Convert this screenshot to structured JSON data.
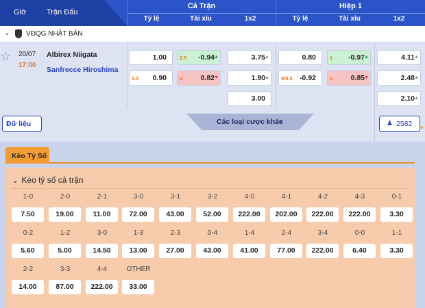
{
  "header": {
    "gio": "Giờ",
    "tran_dau": "Trận Đấu",
    "ca_tran": "Cả Trận",
    "hiep_1": "Hiệp 1",
    "ty_le": "Tỷ lệ",
    "tai_xiu": "Tài xỉu",
    "x12": "1x2"
  },
  "league": {
    "name": "VĐQG NHẬT BẢN"
  },
  "match": {
    "date": "20/07",
    "time": "17:00",
    "home": "Albirex Niigata",
    "away": "Sanfrecce Hiroshima",
    "full": {
      "tyle1": {
        "val": "1.00"
      },
      "tyle2": {
        "pre": "0.5",
        "val": "0.90"
      },
      "tx1": {
        "pre": "2.5",
        "val": "-0.94"
      },
      "tx2": {
        "pre": "u",
        "val": "0.82"
      },
      "x1": "3.75",
      "x2": "1.90",
      "x3": "3.00"
    },
    "half": {
      "tyle1": {
        "val": "0.80"
      },
      "tyle2": {
        "pre": "0/0.5",
        "val": "-0.92"
      },
      "tx1": {
        "pre": "1",
        "val": "-0.97"
      },
      "tx2": {
        "pre": "u",
        "val": "0.85"
      },
      "x1": "4.11",
      "x2": "2.48",
      "x3": "2.10"
    },
    "du_lieu": "Dữ liệu",
    "cac_loai": "Các loại cược khác",
    "count": "2582"
  },
  "tab": {
    "label": "Kèo Tỷ Số"
  },
  "panel": {
    "title": "Kèo tỷ số cả trận",
    "scores": [
      {
        "label": "1-0",
        "odds": "7.50"
      },
      {
        "label": "2-0",
        "odds": "19.00"
      },
      {
        "label": "2-1",
        "odds": "11.00"
      },
      {
        "label": "3-0",
        "odds": "72.00"
      },
      {
        "label": "3-1",
        "odds": "43.00"
      },
      {
        "label": "3-2",
        "odds": "52.00"
      },
      {
        "label": "4-0",
        "odds": "222.00"
      },
      {
        "label": "4-1",
        "odds": "202.00"
      },
      {
        "label": "4-2",
        "odds": "222.00"
      },
      {
        "label": "4-3",
        "odds": "222.00"
      },
      {
        "label": "0-1",
        "odds": "3.30"
      },
      {
        "label": "0-2",
        "odds": "5.60"
      },
      {
        "label": "1-2",
        "odds": "5.00"
      },
      {
        "label": "3-0",
        "odds": "14.50"
      },
      {
        "label": "1-3",
        "odds": "13.00"
      },
      {
        "label": "2-3",
        "odds": "27.00"
      },
      {
        "label": "0-4",
        "odds": "43.00"
      },
      {
        "label": "1-4",
        "odds": "41.00"
      },
      {
        "label": "2-4",
        "odds": "77.00"
      },
      {
        "label": "3-4",
        "odds": "222.00"
      },
      {
        "label": "0-0",
        "odds": "6.40"
      },
      {
        "label": "1-1",
        "odds": "3.30"
      },
      {
        "label": "2-2",
        "odds": "14.00"
      },
      {
        "label": "3-3",
        "odds": "87.00"
      },
      {
        "label": "4-4",
        "odds": "222.00"
      },
      {
        "label": "OTHER",
        "odds": "33.00"
      }
    ]
  },
  "colors": {
    "header_blue": "#2b54c8",
    "accent_orange": "#f39c34",
    "panel_peach": "#f7ccac",
    "up_green": "#2a9a3e",
    "down_red": "#d32f2f"
  }
}
